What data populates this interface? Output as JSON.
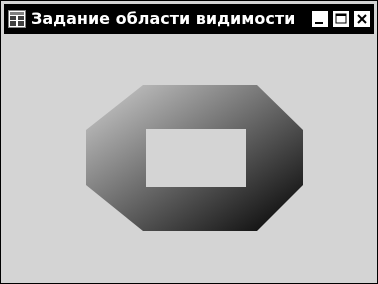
{
  "window": {
    "title": "Задание области видимости",
    "icon": "window-app-icon",
    "controls": [
      "minimize-icon",
      "maximize-icon",
      "close-icon"
    ]
  },
  "canvas": {
    "shape": "octagon-frame-with-rect-hole",
    "gradient_start": "#d0d0d0",
    "gradient_end": "#000000",
    "hole_color": "#d4d4d4",
    "background": "#d4d4d4"
  }
}
